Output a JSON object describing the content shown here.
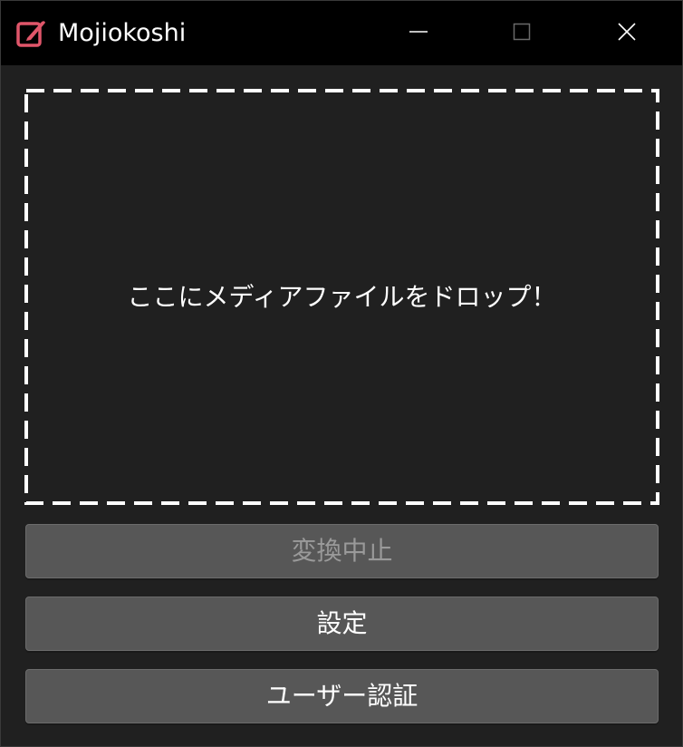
{
  "window": {
    "title": "Mojiokoshi",
    "icon": "pencil-note-icon",
    "accent_color": "#e0566a",
    "controls": {
      "minimize_icon": "minimize-icon",
      "maximize_icon": "maximize-icon",
      "close_icon": "close-icon"
    }
  },
  "drop_zone": {
    "text": "ここにメディアファイルをドロップ！"
  },
  "buttons": {
    "stop_label": "変換中止",
    "settings_label": "設定",
    "auth_label": "ユーザー認証"
  }
}
